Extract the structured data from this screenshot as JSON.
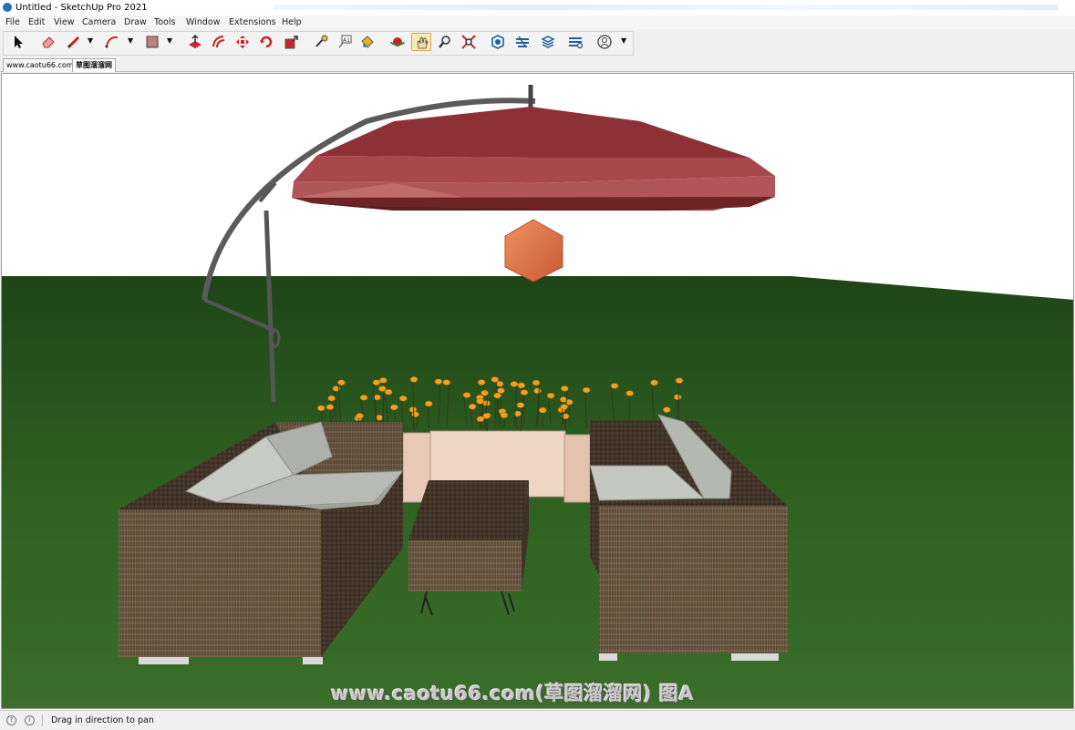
{
  "window": {
    "title": "Untitled - SketchUp Pro 2021"
  },
  "menu": [
    "File",
    "Edit",
    "View",
    "Camera",
    "Draw",
    "Tools",
    "Window",
    "Extensions",
    "Help"
  ],
  "toolbar": {
    "tools": [
      {
        "name": "select-tool-icon"
      },
      {
        "name": "eraser-tool-icon"
      },
      {
        "name": "line-tool-icon",
        "dropdown": true
      },
      {
        "name": "arc-tool-icon",
        "dropdown": true
      },
      {
        "name": "shape-tool-icon",
        "dropdown": true
      },
      {
        "name": "push-pull-tool-icon"
      },
      {
        "name": "offset-tool-icon"
      },
      {
        "name": "move-tool-icon"
      },
      {
        "name": "rotate-tool-icon"
      },
      {
        "name": "scale-tool-icon"
      },
      {
        "name": "tape-measure-tool-icon"
      },
      {
        "name": "text-tool-icon"
      },
      {
        "name": "paint-bucket-tool-icon"
      },
      {
        "name": "orbit-tool-icon"
      },
      {
        "name": "pan-tool-icon",
        "active": true
      },
      {
        "name": "zoom-tool-icon"
      },
      {
        "name": "zoom-extents-tool-icon"
      },
      {
        "name": "3d-warehouse-icon"
      },
      {
        "name": "extension-warehouse-icon"
      },
      {
        "name": "layout-icon"
      },
      {
        "name": "extension-manager-icon"
      },
      {
        "name": "user-account-icon",
        "dropdown": true
      }
    ]
  },
  "tabs": [
    "www.caotu66.com",
    "草图溜溜网"
  ],
  "viewport": {
    "watermark": "www.caotu66.com(草图溜溜网) 图A",
    "colors": {
      "sky": "#ffffff",
      "grass": "#2c5a1e",
      "umbrella": "#8a2f33",
      "lantern": "#e07048",
      "wicker": "#6f5a42",
      "cushion": "#b9bcb4",
      "planter": "#e9cbb8",
      "flower": "#f2a11c"
    }
  },
  "status": {
    "message": "Drag in direction to pan"
  }
}
